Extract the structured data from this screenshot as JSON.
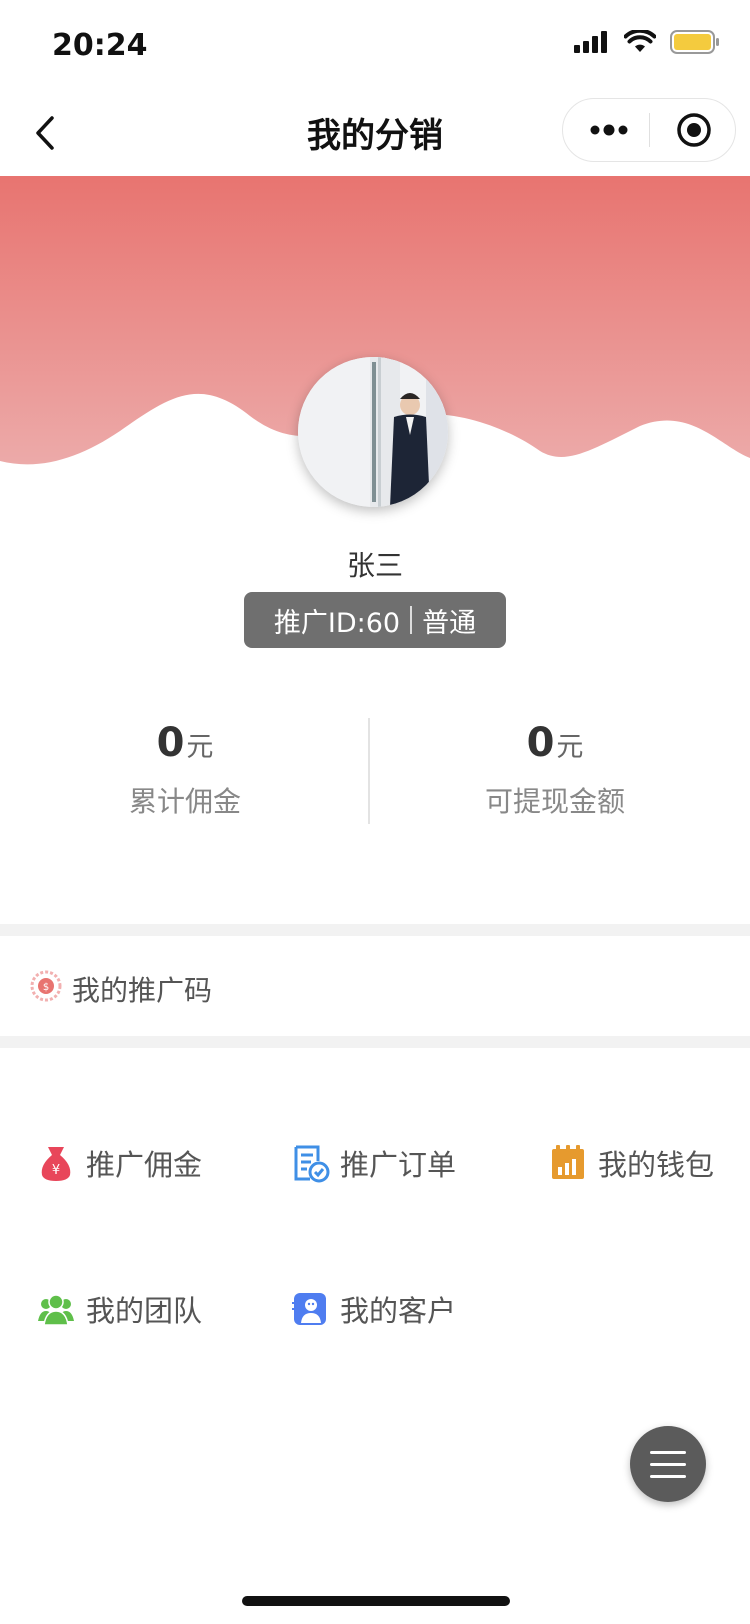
{
  "status_bar": {
    "time": "20:24"
  },
  "nav": {
    "title": "我的分销"
  },
  "profile": {
    "name": "张三",
    "promo_id": "推广ID:60",
    "level": "普通"
  },
  "stats": [
    {
      "value": "0",
      "unit": "元",
      "label": "累计佣金"
    },
    {
      "value": "0",
      "unit": "元",
      "label": "可提现金额"
    }
  ],
  "promo_code": {
    "label": "我的推广码",
    "icon": "promo-code-icon"
  },
  "menu": [
    {
      "label": "推广佣金",
      "icon": "money-bag-icon",
      "color": "#e8465a"
    },
    {
      "label": "推广订单",
      "icon": "order-list-icon",
      "color": "#3f8fe6"
    },
    {
      "label": "我的钱包",
      "icon": "wallet-chart-icon",
      "color": "#e69a2e"
    },
    {
      "label": "我的团队",
      "icon": "team-icon",
      "color": "#5fbf4a"
    },
    {
      "label": "我的客户",
      "icon": "customer-icon",
      "color": "#4f7df0"
    }
  ],
  "colors": {
    "hero_top": "#e87470",
    "hero_bottom": "#ecaaa9",
    "badge_bg": "#6f6f6f"
  }
}
